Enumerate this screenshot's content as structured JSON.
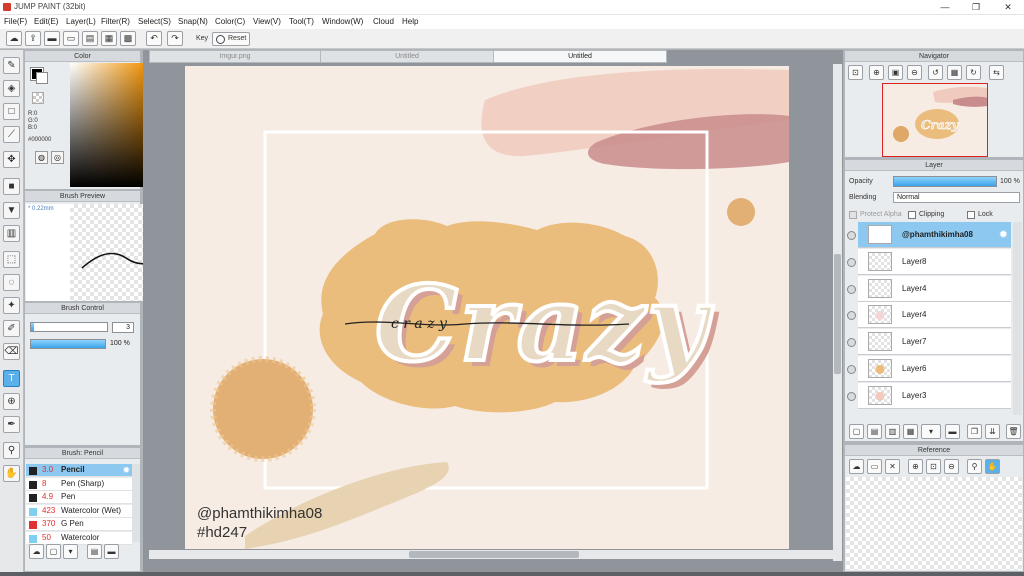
{
  "window": {
    "title": "JUMP PAINT (32bit)",
    "minimize": "—",
    "maximize": "❐",
    "close": "✕"
  },
  "menu": [
    "File(F)",
    "Edit(E)",
    "Layer(L)",
    "Filter(R)",
    "Select(S)",
    "Snap(N)",
    "Color(C)",
    "View(V)",
    "Tool(T)",
    "Window(W)",
    "Cloud",
    "Help"
  ],
  "toolbar": {
    "key_label": "Key",
    "reset_label": "Reset"
  },
  "color_panel": {
    "title": "Color",
    "r": "R:0",
    "g": "G:0",
    "b": "B:0",
    "hex": "#000000",
    "foreground": "#000000",
    "background": "#ffffff"
  },
  "brush_preview": {
    "title": "Brush Preview",
    "size": "* 0.22mm"
  },
  "brush_control": {
    "title": "Brush Control",
    "size_value": "3",
    "opacity_value": "100 %",
    "opacity_fraction": 1.0
  },
  "brush_list": {
    "title": "Brush: Pencil",
    "items": [
      {
        "size": "3.0",
        "name": "Pencil",
        "color": "#222222",
        "selected": true
      },
      {
        "size": "8",
        "name": "Pen (Sharp)",
        "color": "#222222",
        "selected": false
      },
      {
        "size": "4.9",
        "name": "Pen",
        "color": "#222222",
        "selected": false
      },
      {
        "size": "423",
        "name": "Watercolor (Wet)",
        "color": "#7fd0f0",
        "selected": false
      },
      {
        "size": "370",
        "name": "G Pen",
        "color": "#e03030",
        "selected": false
      },
      {
        "size": "50",
        "name": "Watercolor",
        "color": "#7fd0f0",
        "selected": false
      }
    ]
  },
  "tabs": [
    {
      "label": "Imgur.png",
      "active": false
    },
    {
      "label": "Untitled",
      "active": false
    },
    {
      "label": "Untitled",
      "active": true
    }
  ],
  "artwork": {
    "main_text": "Crazy",
    "script_text": "c r a z y",
    "watermark": "@phamthikimha08",
    "hashtag": "#hd247",
    "colors": {
      "background": "#f6ece4",
      "blob": "#ebbd7c",
      "pink_stroke": "#f0cbbd",
      "mauve_stroke": "#c98c8c",
      "gold": "#e0a868",
      "tan_stroke": "#e6cfab",
      "letter": "#e8d9c4",
      "letter_shadow": "#d5a096"
    }
  },
  "navigator": {
    "title": "Navigator"
  },
  "layer_panel": {
    "title": "Layer",
    "opacity_label": "Opacity",
    "opacity_value": "100 %",
    "blending_label": "Blending",
    "blending_value": "Normal",
    "protect_alpha": "Protect Alpha",
    "clipping": "Clipping",
    "lock": "Lock",
    "layers": [
      {
        "name": "@phamthikimha08",
        "selected": true
      },
      {
        "name": "Layer8",
        "selected": false
      },
      {
        "name": "Layer4",
        "selected": false
      },
      {
        "name": "Layer4",
        "selected": false
      },
      {
        "name": "Layer7",
        "selected": false
      },
      {
        "name": "Layer6",
        "selected": false
      },
      {
        "name": "Layer3",
        "selected": false
      }
    ]
  },
  "reference": {
    "title": "Reference"
  }
}
